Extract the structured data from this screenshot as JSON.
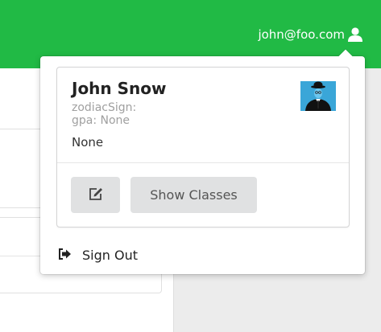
{
  "header": {
    "user_email": "john@foo.com",
    "user_icon": "user-icon",
    "bg_color": "#21ba45"
  },
  "profile": {
    "name": "John Snow",
    "zodiac_line": "zodiacSign:",
    "gpa_line": "gpa: None",
    "description": "None",
    "avatar": "spy-avatar"
  },
  "actions": {
    "edit_icon": "edit-icon",
    "show_classes_label": "Show Classes"
  },
  "menu": {
    "sign_out_label": "Sign Out",
    "sign_out_icon": "sign-out-icon"
  }
}
